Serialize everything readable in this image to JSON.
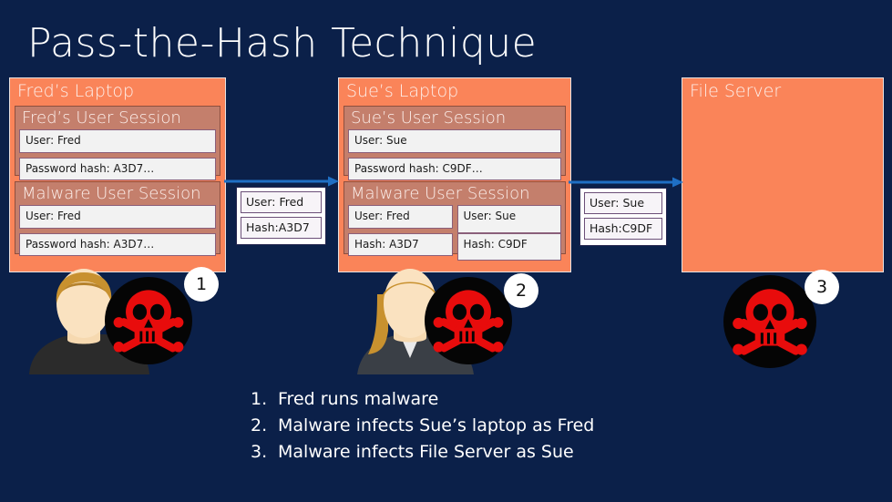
{
  "slide": {
    "title": "Pass-the-Hash Technique",
    "background_color": "#0b2049",
    "panel_color": "#fa8459",
    "session_color": "#c47f6c",
    "arrow_color": "#1f6fc4"
  },
  "panels": [
    {
      "name": "freds-laptop",
      "title": "Fred’s Laptop",
      "sessions": [
        {
          "title": "Fred’s User Session",
          "fields": [
            [
              "User: Fred"
            ],
            [
              "Password hash: A3D7…"
            ]
          ]
        },
        {
          "title": "Malware User Session",
          "fields": [
            [
              "User: Fred"
            ],
            [
              "Password hash: A3D7…"
            ]
          ]
        }
      ]
    },
    {
      "name": "sues-laptop",
      "title": "Sue’s Laptop",
      "sessions": [
        {
          "title": "Sue’s User Session",
          "fields": [
            [
              "User: Sue"
            ],
            [
              "Password hash: C9DF…"
            ]
          ]
        },
        {
          "title": "Malware User Session",
          "fields": [
            [
              "User: Fred",
              "User: Sue"
            ],
            [
              "Hash: A3D7",
              "Hash: C9DF"
            ]
          ]
        }
      ]
    },
    {
      "name": "file-server",
      "title": "File Server",
      "sessions": []
    }
  ],
  "packets": [
    {
      "name": "packet-fred-credentials",
      "fields": [
        "User: Fred",
        "Hash:A3D7"
      ]
    },
    {
      "name": "packet-sue-credentials",
      "fields": [
        "User: Sue",
        "Hash:C9DF"
      ]
    }
  ],
  "badges": [
    {
      "label": "1"
    },
    {
      "label": "2"
    },
    {
      "label": "3"
    }
  ],
  "legend": {
    "items": [
      {
        "num": "1.",
        "text": "Fred runs malware"
      },
      {
        "num": "2.",
        "text": "Malware infects Sue’s laptop as Fred"
      },
      {
        "num": "3.",
        "text": "Malware infects File Server as Sue"
      }
    ]
  }
}
